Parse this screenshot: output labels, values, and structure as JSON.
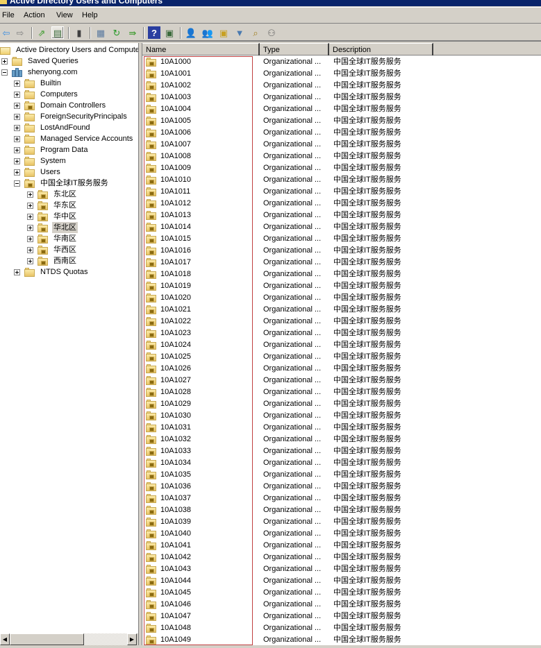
{
  "window": {
    "title": "Active Directory Users and Computers"
  },
  "menu": [
    "File",
    "Action",
    "View",
    "Help"
  ],
  "toolbar": {
    "buttons": [
      {
        "name": "back-icon",
        "glyph": "⇦",
        "color": "#3c8ee0"
      },
      {
        "name": "forward-icon",
        "glyph": "⇨",
        "color": "#808080"
      },
      {
        "name": "up-one-level-icon",
        "glyph": "⇗",
        "color": "#3a9a2a"
      },
      {
        "name": "show-hide-console-tree-icon",
        "glyph": "▤",
        "color": "#3a6a3a",
        "active": true
      },
      {
        "name": "clipboard-icon",
        "glyph": "▮",
        "color": "#404040"
      },
      {
        "name": "properties-icon",
        "glyph": "▦",
        "color": "#5a7aa0"
      },
      {
        "name": "refresh-icon",
        "glyph": "↻",
        "color": "#2a9a2a"
      },
      {
        "name": "export-list-icon",
        "glyph": "⇛",
        "color": "#3a9a2a"
      },
      {
        "name": "help-icon",
        "glyph": "?",
        "color": "#ffffff",
        "bg": "#2a3ea0"
      },
      {
        "name": "show-action-pane-icon",
        "glyph": "▣",
        "color": "#3a6a3a"
      },
      {
        "name": "new-user-icon",
        "glyph": "👤",
        "color": "#2a5a9a"
      },
      {
        "name": "new-group-icon",
        "glyph": "👥",
        "color": "#3a8a3a"
      },
      {
        "name": "new-ou-icon",
        "glyph": "▣",
        "color": "#c8a020"
      },
      {
        "name": "filter-icon",
        "glyph": "▼",
        "color": "#4a7ab0"
      },
      {
        "name": "find-icon",
        "glyph": "⌕",
        "color": "#a08020"
      },
      {
        "name": "add-to-group-icon",
        "glyph": "⚇",
        "color": "#606060"
      }
    ]
  },
  "tree": {
    "root": "Active Directory Users and Computers",
    "items": [
      {
        "label": "Saved Queries",
        "level": 1,
        "expander": "plus",
        "icon": "folder"
      },
      {
        "label": "shenyong.com",
        "level": 1,
        "expander": "minus",
        "icon": "domain"
      },
      {
        "label": "Builtin",
        "level": 2,
        "expander": "plus",
        "icon": "folder"
      },
      {
        "label": "Computers",
        "level": 2,
        "expander": "plus",
        "icon": "folder"
      },
      {
        "label": "Domain Controllers",
        "level": 2,
        "expander": "plus",
        "icon": "ou"
      },
      {
        "label": "ForeignSecurityPrincipals",
        "level": 2,
        "expander": "plus",
        "icon": "folder"
      },
      {
        "label": "LostAndFound",
        "level": 2,
        "expander": "plus",
        "icon": "folder"
      },
      {
        "label": "Managed Service Accounts",
        "level": 2,
        "expander": "plus",
        "icon": "folder"
      },
      {
        "label": "Program Data",
        "level": 2,
        "expander": "plus",
        "icon": "folder"
      },
      {
        "label": "System",
        "level": 2,
        "expander": "plus",
        "icon": "folder"
      },
      {
        "label": "Users",
        "level": 2,
        "expander": "plus",
        "icon": "folder"
      },
      {
        "label": "中国全球IT服务服务",
        "level": 2,
        "expander": "minus",
        "icon": "ou"
      },
      {
        "label": "东北区",
        "level": 3,
        "expander": "plus",
        "icon": "ou"
      },
      {
        "label": "华东区",
        "level": 3,
        "expander": "plus",
        "icon": "ou"
      },
      {
        "label": "华中区",
        "level": 3,
        "expander": "plus",
        "icon": "ou"
      },
      {
        "label": "华北区",
        "level": 3,
        "expander": "plus",
        "icon": "ou",
        "selected": true
      },
      {
        "label": "华南区",
        "level": 3,
        "expander": "plus",
        "icon": "ou"
      },
      {
        "label": "华西区",
        "level": 3,
        "expander": "plus",
        "icon": "ou"
      },
      {
        "label": "西南区",
        "level": 3,
        "expander": "plus",
        "icon": "ou"
      },
      {
        "label": "NTDS Quotas",
        "level": 2,
        "expander": "plus",
        "icon": "folder"
      }
    ]
  },
  "list": {
    "columns": [
      "Name",
      "Type",
      "Description"
    ],
    "type_value": "Organizational ...",
    "description_value": "中国全球IT服务服务",
    "rows": [
      "10A1000",
      "10A1001",
      "10A1002",
      "10A1003",
      "10A1004",
      "10A1005",
      "10A1006",
      "10A1007",
      "10A1008",
      "10A1009",
      "10A1010",
      "10A1011",
      "10A1012",
      "10A1013",
      "10A1014",
      "10A1015",
      "10A1016",
      "10A1017",
      "10A1018",
      "10A1019",
      "10A1020",
      "10A1021",
      "10A1022",
      "10A1023",
      "10A1024",
      "10A1025",
      "10A1026",
      "10A1027",
      "10A1028",
      "10A1029",
      "10A1030",
      "10A1031",
      "10A1032",
      "10A1033",
      "10A1034",
      "10A1035",
      "10A1036",
      "10A1037",
      "10A1038",
      "10A1039",
      "10A1040",
      "10A1041",
      "10A1042",
      "10A1043",
      "10A1044",
      "10A1045",
      "10A1046",
      "10A1047",
      "10A1048",
      "10A1049"
    ]
  },
  "scrollbar": {
    "left_arrow": "◀",
    "right_arrow": "▶"
  }
}
